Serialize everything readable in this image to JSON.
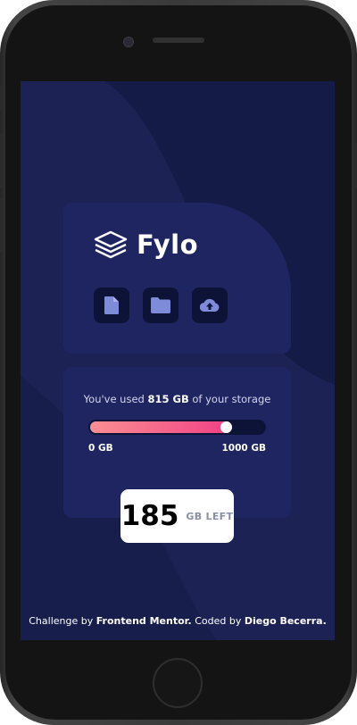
{
  "app": {
    "brand": "Fylo"
  },
  "toolbar": {
    "items": [
      {
        "name": "document-icon"
      },
      {
        "name": "folder-icon"
      },
      {
        "name": "upload-icon"
      }
    ]
  },
  "storage": {
    "usage_prefix": "You've used",
    "used_amount": "815 GB",
    "usage_suffix": "of your storage",
    "used_fraction": 0.815,
    "scale_min": "0 GB",
    "scale_max": "1000 GB",
    "remaining_value": "185",
    "remaining_label": "GB LEFT"
  },
  "footer": {
    "challenge_prefix": "Challenge by",
    "challenge_org": "Frontend Mentor.",
    "coded_prefix": "Coded by",
    "author": "Diego Becerra."
  },
  "colors": {
    "background": "#1b2049",
    "card": "#1f2560",
    "icon_tile": "#0c1337",
    "icon_fill": "#7e8bd9",
    "bar_start": "#fb8f92",
    "bar_end": "#f13f85"
  }
}
